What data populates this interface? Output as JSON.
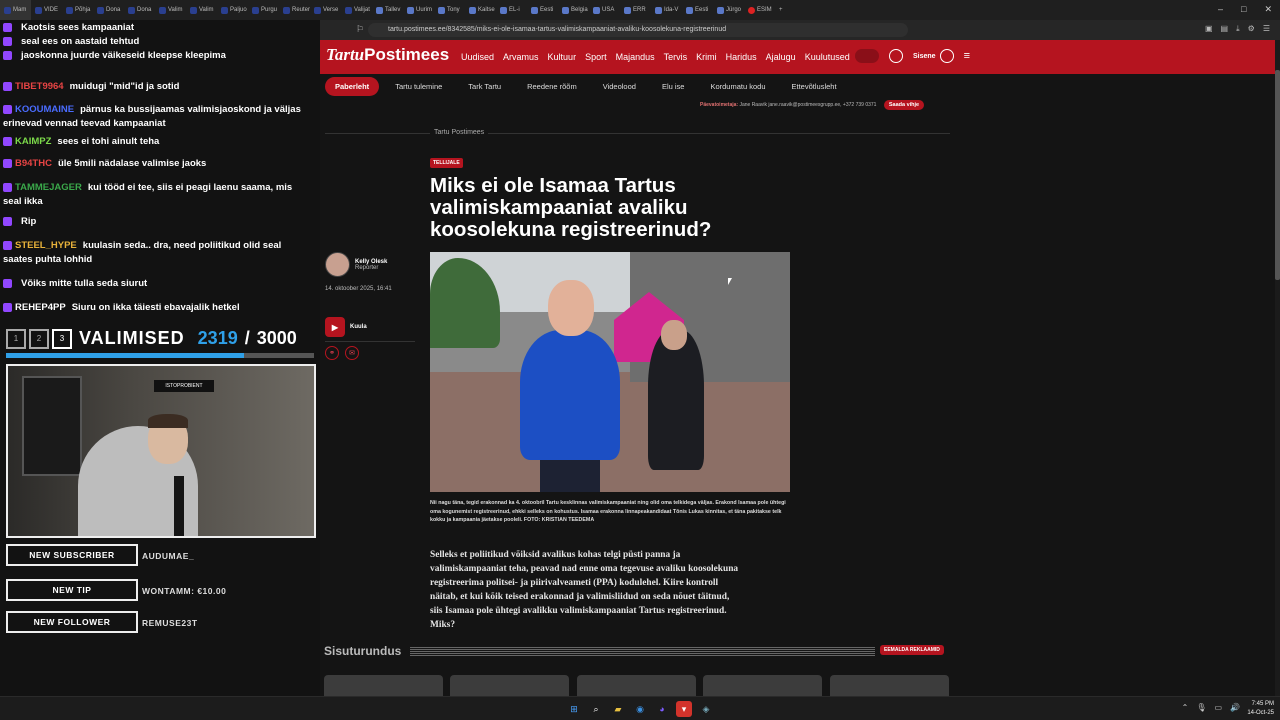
{
  "browser": {
    "tabs": [
      "Mam",
      "VIDE",
      "Põhja",
      "Dona",
      "Dona",
      "Valim",
      "Valim",
      "Paljuo",
      "Purgu",
      "Reuter",
      "Verse",
      "Valijat",
      "Tallev",
      "Uurim",
      "Tony",
      "Kaitse",
      "EL-i",
      "Eesti",
      "Belgia",
      "USA",
      "ERR",
      "Ida-V",
      "Eesti",
      "Jürgo",
      "ESIM"
    ],
    "url": "tartu.postimees.ee/8342585/miks-ei-ole-isamaa-tartus-valimiskampaaniat-avaliku-koosolekuna-registreerinud"
  },
  "overlay": {
    "chat": [
      {
        "user": "",
        "text": "Kaotsis sees kampaaniat"
      },
      {
        "user": "",
        "text": "seal ees on aastaid tehtud"
      },
      {
        "user": "",
        "text": "jaoskonna juurde väikeseid kleepse kleepima"
      },
      {
        "user": "TIBET9964",
        "text": "muidugi \"mid\"id ja sotid"
      },
      {
        "user": "KOOUMAINE",
        "text": "pärnus ka bussijaamas valimisjaoskond ja väljas erinevad vennad teevad kampaaniat"
      },
      {
        "user": "KAIMPZ",
        "text": "sees ei tohi ainult teha"
      },
      {
        "user": "B94THC",
        "text": "üle 5mili nädalase valimise jaoks"
      },
      {
        "user": "TAMMEJAGER",
        "text": "kui tööd ei tee, siis ei peagi laenu saama, mis seal ikka"
      },
      {
        "user": "",
        "text": "Rip"
      },
      {
        "user": "STEEL_HYPE",
        "text": "kuulasin seda.. dra, need poliitikud olid seal saates puhta lohhid"
      },
      {
        "user": "",
        "text": "Võiks mitte tulla seda siurut"
      },
      {
        "user": "REHEP4PP",
        "text": "Siuru on ikka täiesti ebavajalik hetkel"
      }
    ],
    "counter": {
      "steps": [
        "1",
        "2",
        "3"
      ],
      "label": "VALIMISED",
      "current": "2319",
      "separator": "/",
      "total": "3000",
      "progress": 0.773
    },
    "cam_sign": "ISTOPROBIENT",
    "alerts": [
      {
        "button": "NEW SUBSCRIBER",
        "value": "AUDUMAE_"
      },
      {
        "button": "NEW TIP",
        "value": "WONTAMM: €10.00"
      },
      {
        "button": "NEW FOLLOWER",
        "value": "REMUSE23T"
      }
    ]
  },
  "site": {
    "logo_a": "Tartu",
    "logo_b": "Postimees",
    "nav": [
      "Uudised",
      "Arvamus",
      "Kultuur",
      "Sport",
      "Majandus",
      "Tervis",
      "Krimi",
      "Haridus",
      "Ajalugu",
      "Kuulutused"
    ],
    "login": "Sisene",
    "subnav": [
      "Paberleht",
      "Tartu tulemine",
      "Tark Tartu",
      "Reedene rõõm",
      "Videolood",
      "Elu ise",
      "Kordumatu kodu",
      "Ettevõtlusleht"
    ],
    "editor_prefix": "Päevatoimetaja:",
    "editor_name": "Jane Raavik",
    "editor_contact": "jane.raavik@postimeesgrupp.ee, +372 739 0371",
    "tip_button": "Saada vihje",
    "section": "Tartu Postimees",
    "tag": "TELLIJALE",
    "headline": "Miks ei ole Isamaa Tartus valimiskampaaniat avaliku koosolekuna registreerinud?",
    "author_name": "Kelly Olesk",
    "author_role": "Reporter",
    "date": "14. oktoober 2025, 16:41",
    "listen": "Kuula",
    "caption": "Nii nagu täna, tegid erakonnad ka 4. oktoobril Tartu kesklinnas valimiskampaaniat ning olid oma telkidega väljas. Erakond Isamaa pole ühtegi oma kogunemist registreerinud, ehkki selleks on kohustus. Isamaa erakonna linnapeakandidaat Tõnis Lukas kinnitas, et täna pakitakse telk kokku ja kampaania jäetakse pooleli. FOTO: KRISTIAN TEEDEMA",
    "body": "Selleks et poliitikud võiksid avalikus kohas telgi püsti panna ja valimiskampaaniat teha, peavad nad enne oma tegevuse avaliku koosolekuna registreerima politsei- ja piirivalveameti (PPA) kodulehel. Kiire kontroll näitab, et kui kõik teised erakonnad ja valimisliidud on seda nõuet täitnud, siis Isamaa pole ühtegi avalikku valimiskampaaniat Tartus registreerinud. Miks?",
    "sponsored": "Sisuturundus",
    "remove_ads": "EEMALDA REKLAAMID"
  },
  "taskbar": {
    "time": "7:45 PM",
    "date": "14-Oct-25"
  }
}
